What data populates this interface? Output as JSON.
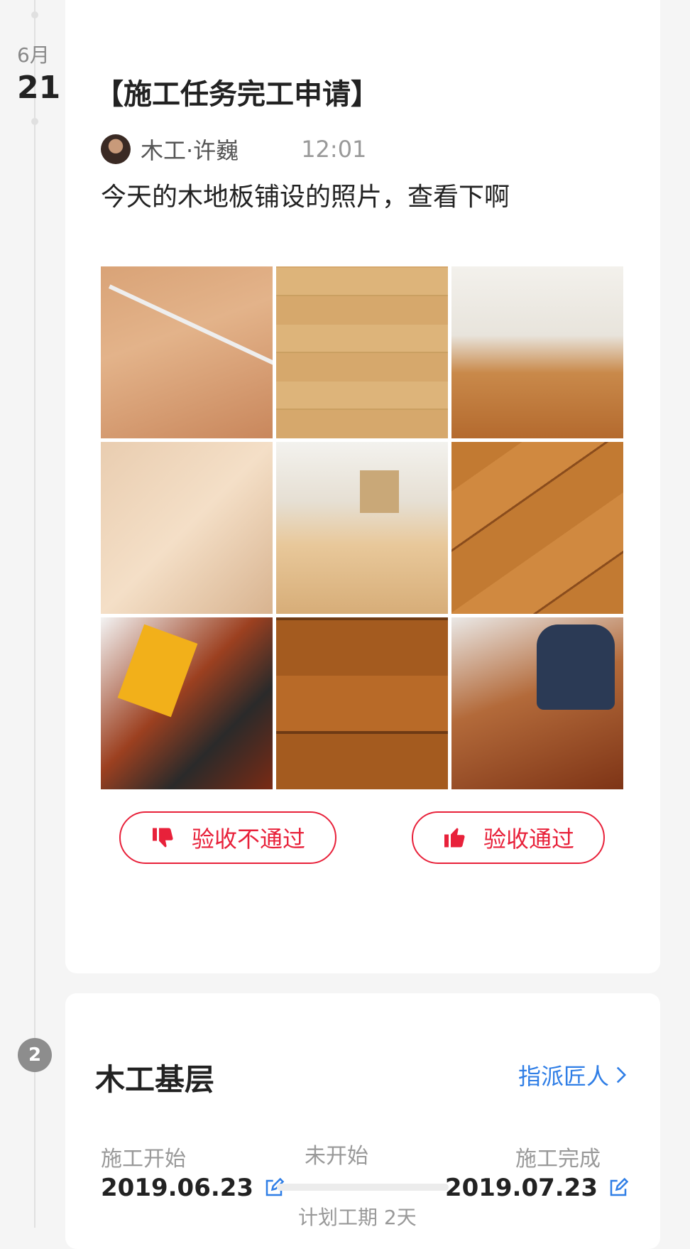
{
  "timeline": {
    "date_month": "6月",
    "date_day": "21",
    "step_number": "2"
  },
  "task_card": {
    "title": "【施工任务完工申请】",
    "author": "木工·许巍",
    "time": "12:01",
    "message": "今天的木地板铺设的照片，查看下啊",
    "photos": [
      "photo-1",
      "photo-2",
      "photo-3",
      "photo-4",
      "photo-5",
      "photo-6",
      "photo-7",
      "photo-8",
      "photo-9"
    ],
    "reject_label": "验收不通过",
    "approve_label": "验收通过"
  },
  "stage_card": {
    "title": "木工基层",
    "assign_label": "指派匠人",
    "start_label": "施工开始",
    "start_date": "2019.06.23",
    "status": "未开始",
    "progress": 0,
    "plan": "计划工期  2天",
    "end_label": "施工完成",
    "end_date": "2019.07.23"
  },
  "colors": {
    "accent_red": "#e8213a",
    "link_blue": "#2f7ee6",
    "muted_gray": "#999999"
  }
}
